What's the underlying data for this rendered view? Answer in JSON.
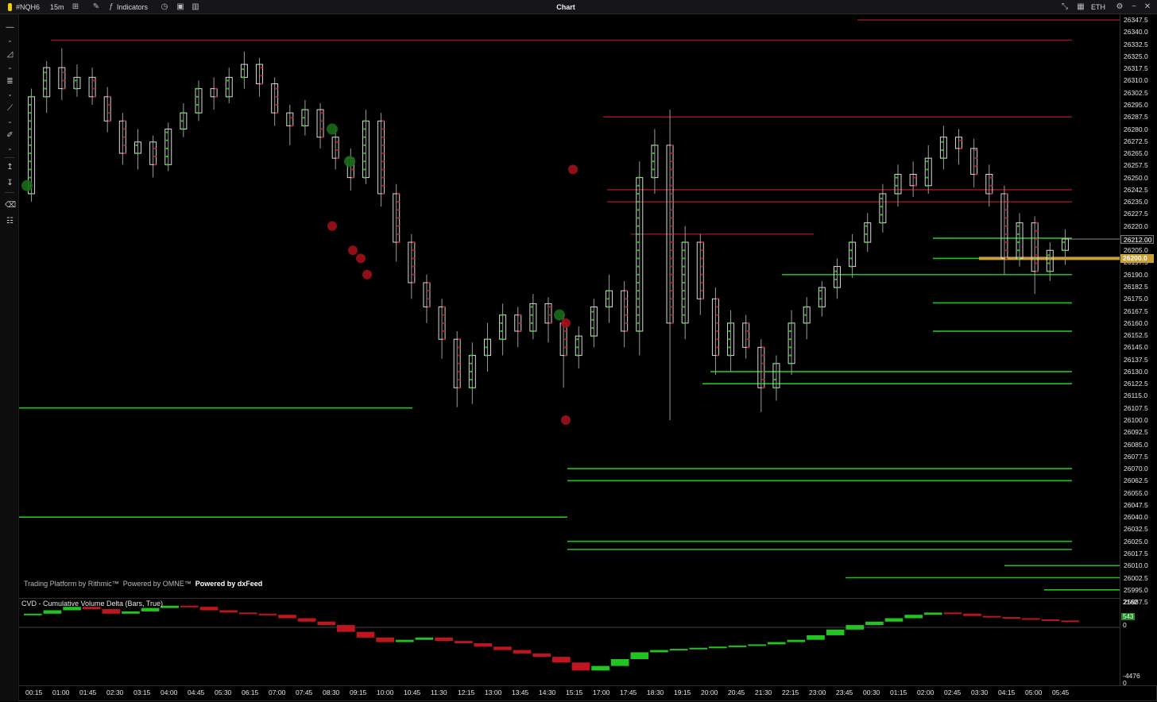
{
  "topbar": {
    "symbol": "#NQH6",
    "timeframe": "15m",
    "indicators_label": "Indicators",
    "title": "Chart",
    "session": "ETH"
  },
  "watermark": {
    "rithmic": "Trading Platform by Rithmic™",
    "omne": "Powered by OMNE™",
    "dxfeed": "Powered by dxFeed"
  },
  "cvd": {
    "title": "CVD - Cumulative Volume Delta (Bars, True)",
    "top_value": "2162",
    "zero_value": "0",
    "current_value": "543",
    "bottom_value": "-4476",
    "bottom_zero": "0"
  },
  "price_axis": {
    "ticks": [
      "26347.5",
      "26340.0",
      "26332.5",
      "26325.0",
      "26317.5",
      "26310.0",
      "26302.5",
      "26295.0",
      "26287.5",
      "26280.0",
      "26272.5",
      "26265.0",
      "26257.5",
      "26250.0",
      "26242.5",
      "26235.0",
      "26227.5",
      "26220.0",
      "26212.5",
      "26205.0",
      "26197.5",
      "26190.0",
      "26182.5",
      "26175.0",
      "26167.5",
      "26160.0",
      "26152.5",
      "26145.0",
      "26137.5",
      "26130.0",
      "26122.5",
      "26115.0",
      "26107.5",
      "26100.0",
      "26092.5",
      "26085.0",
      "26077.5",
      "26070.0",
      "26062.5",
      "26055.0",
      "26047.5",
      "26040.0",
      "26032.5",
      "26025.0",
      "26017.5",
      "26010.0",
      "26002.5",
      "25995.0",
      "25987.5"
    ],
    "last_price": "26212.00",
    "highlight_price": "26200.0"
  },
  "time_axis": [
    "00:15",
    "01:00",
    "01:45",
    "02:30",
    "03:15",
    "04:00",
    "04:45",
    "05:30",
    "06:15",
    "07:00",
    "07:45",
    "08:30",
    "09:15",
    "10:00",
    "10:45",
    "11:30",
    "12:15",
    "13:00",
    "13:45",
    "14:30",
    "15:15",
    "17:00",
    "17:45",
    "18:30",
    "19:15",
    "20:00",
    "20:45",
    "21:30",
    "22:15",
    "23:00",
    "23:45",
    "00:30",
    "01:15",
    "02:00",
    "02:45",
    "03:30",
    "04:15",
    "05:00",
    "05:45"
  ],
  "colors": {
    "up": "#22c422",
    "down": "#c0151f",
    "level_green": "#21c021",
    "level_red": "#9a1520",
    "highlight": "#c8a032"
  },
  "chart_data": {
    "type": "candlestick",
    "ylim": [
      25987.5,
      26350.0
    ],
    "candles": [
      [
        26240,
        26300,
        26235,
        26305
      ],
      [
        26300,
        26318,
        26290,
        26322
      ],
      [
        26318,
        26305,
        26298,
        26330
      ],
      [
        26305,
        26312,
        26300,
        26320
      ],
      [
        26312,
        26300,
        26295,
        26318
      ],
      [
        26300,
        26285,
        26278,
        26306
      ],
      [
        26285,
        26265,
        26258,
        26290
      ],
      [
        26265,
        26272,
        26255,
        26280
      ],
      [
        26272,
        26258,
        26250,
        26276
      ],
      [
        26258,
        26280,
        26254,
        26284
      ],
      [
        26280,
        26290,
        26275,
        26296
      ],
      [
        26290,
        26305,
        26285,
        26310
      ],
      [
        26305,
        26300,
        26292,
        26312
      ],
      [
        26300,
        26312,
        26296,
        26318
      ],
      [
        26312,
        26320,
        26305,
        26328
      ],
      [
        26320,
        26308,
        26300,
        26324
      ],
      [
        26308,
        26290,
        26282,
        26312
      ],
      [
        26290,
        26282,
        26270,
        26295
      ],
      [
        26282,
        26292,
        26276,
        26298
      ],
      [
        26292,
        26275,
        26268,
        26296
      ],
      [
        26275,
        26262,
        26255,
        26280
      ],
      [
        26262,
        26250,
        26242,
        26268
      ],
      [
        26250,
        26285,
        26246,
        26292
      ],
      [
        26285,
        26240,
        26232,
        26290
      ],
      [
        26240,
        26210,
        26198,
        26246
      ],
      [
        26210,
        26185,
        26175,
        26215
      ],
      [
        26185,
        26170,
        26160,
        26190
      ],
      [
        26170,
        26150,
        26138,
        26175
      ],
      [
        26150,
        26120,
        26108,
        26155
      ],
      [
        26120,
        26140,
        26110,
        26148
      ],
      [
        26140,
        26150,
        26130,
        26160
      ],
      [
        26150,
        26165,
        26140,
        26172
      ],
      [
        26165,
        26155,
        26145,
        26170
      ],
      [
        26155,
        26172,
        26150,
        26178
      ],
      [
        26172,
        26160,
        26148,
        26176
      ],
      [
        26160,
        26140,
        26120,
        26165
      ],
      [
        26140,
        26152,
        26132,
        26158
      ],
      [
        26152,
        26170,
        26145,
        26175
      ],
      [
        26170,
        26180,
        26160,
        26190
      ],
      [
        26180,
        26155,
        26145,
        26186
      ],
      [
        26155,
        26250,
        26140,
        26260
      ],
      [
        26250,
        26270,
        26240,
        26280
      ],
      [
        26270,
        26160,
        26100,
        26292
      ],
      [
        26160,
        26210,
        26150,
        26220
      ],
      [
        26210,
        26175,
        26165,
        26215
      ],
      [
        26175,
        26140,
        26128,
        26182
      ],
      [
        26140,
        26160,
        26130,
        26168
      ],
      [
        26160,
        26145,
        26138,
        26165
      ],
      [
        26145,
        26120,
        26105,
        26150
      ],
      [
        26120,
        26135,
        26112,
        26140
      ],
      [
        26135,
        26160,
        26128,
        26168
      ],
      [
        26160,
        26170,
        26150,
        26176
      ],
      [
        26170,
        26182,
        26164,
        26186
      ],
      [
        26182,
        26195,
        26175,
        26200
      ],
      [
        26195,
        26210,
        26188,
        26215
      ],
      [
        26210,
        26222,
        26204,
        26228
      ],
      [
        26222,
        26240,
        26216,
        26246
      ],
      [
        26240,
        26252,
        26232,
        26258
      ],
      [
        26252,
        26245,
        26238,
        26260
      ],
      [
        26245,
        26262,
        26240,
        26270
      ],
      [
        26262,
        26275,
        26255,
        26282
      ],
      [
        26275,
        26268,
        26258,
        26280
      ],
      [
        26268,
        26252,
        26244,
        26274
      ],
      [
        26252,
        26240,
        26232,
        26258
      ],
      [
        26240,
        26200,
        26190,
        26245
      ],
      [
        26200,
        26222,
        26195,
        26228
      ],
      [
        26222,
        26192,
        26178,
        26226
      ],
      [
        26192,
        26205,
        26186,
        26210
      ],
      [
        26205,
        26212,
        26196,
        26218
      ]
    ],
    "green_levels": [
      26212.5,
      26200,
      26190,
      26172.5,
      26155,
      26130,
      26122.5,
      26107.5,
      26070,
      26062.5,
      26040,
      26025,
      26020,
      26010,
      26002.5,
      25995
    ],
    "red_levels": [
      26347.5,
      26335,
      26287.5,
      26242.5,
      26235,
      26215
    ],
    "cvd_values": [
      1200,
      1500,
      1800,
      1600,
      1200,
      1400,
      1700,
      1900,
      1800,
      1500,
      1300,
      1200,
      1100,
      800,
      500,
      200,
      -400,
      -900,
      -1300,
      -1100,
      -900,
      -1200,
      -1400,
      -1700,
      -2000,
      -2300,
      -2600,
      -3100,
      -3800,
      -3400,
      -2800,
      -2200,
      -2000,
      -1900,
      -1800,
      -1700,
      -1600,
      -1500,
      -1300,
      -1100,
      -700,
      -200,
      200,
      500,
      800,
      1100,
      1300,
      1200,
      1000,
      900,
      800,
      700,
      600,
      543
    ]
  }
}
